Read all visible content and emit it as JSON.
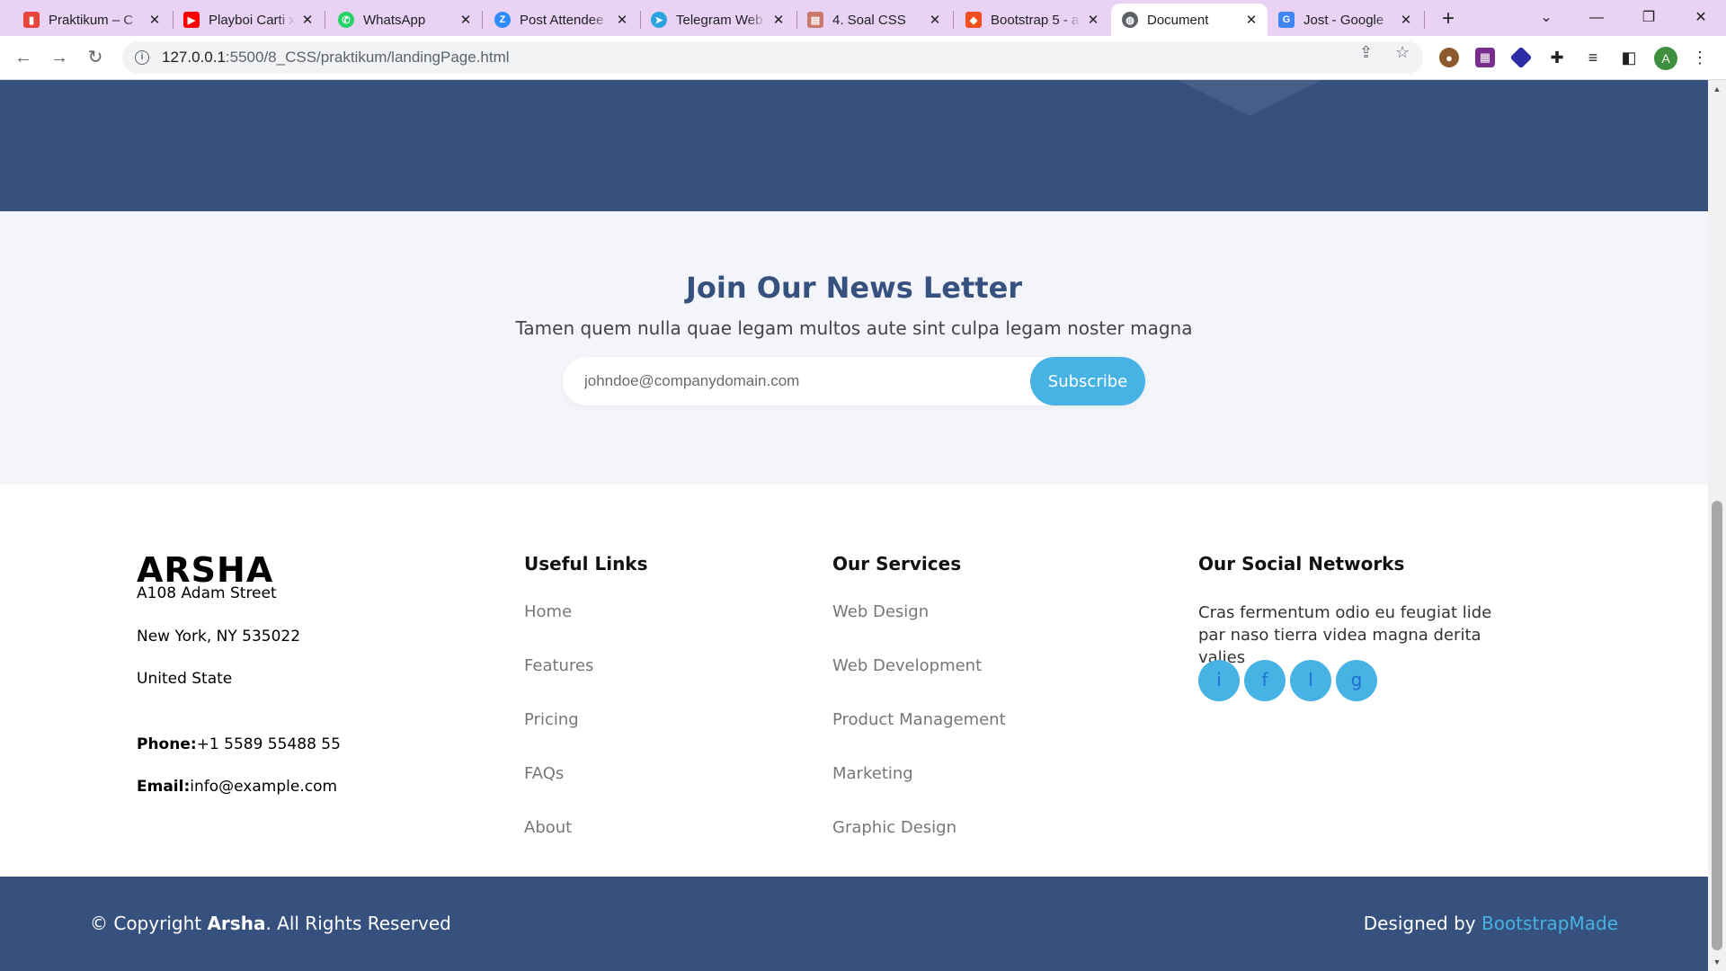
{
  "browser": {
    "tabs": [
      {
        "title": "Praktikum – C",
        "icon": "praktikum-icon",
        "color": "#e8453c"
      },
      {
        "title": "Playboi Carti x",
        "icon": "youtube-icon",
        "color": "#ff0000"
      },
      {
        "title": "WhatsApp",
        "icon": "whatsapp-icon",
        "color": "#25d366"
      },
      {
        "title": "Post Attendee",
        "icon": "zoom-icon",
        "color": "#2d8cff"
      },
      {
        "title": "Telegram Web",
        "icon": "telegram-icon",
        "color": "#2aa3e0"
      },
      {
        "title": "4. Soal CSS",
        "icon": "document-icon",
        "color": "#c9786b"
      },
      {
        "title": "Bootstrap 5 - a",
        "icon": "figma-icon",
        "color": "#f24e1e"
      },
      {
        "title": "Document",
        "icon": "globe-icon",
        "color": "#5f6368"
      },
      {
        "title": "Jost - Google",
        "icon": "google-fonts-icon",
        "color": "#4285f4"
      }
    ],
    "active_tab": 7,
    "new_tab_label": "+",
    "url_host": "127.0.0.1",
    "url_path": ":5500/8_CSS/praktikum/landingPage.html",
    "profile_initial": "A"
  },
  "newsletter": {
    "title": "Join Our News Letter",
    "subtitle": "Tamen quem nulla quae legam multos aute sint culpa legam noster magna",
    "email_placeholder": "johndoe@companydomain.com",
    "subscribe_label": "Subscribe"
  },
  "footer": {
    "brand": "ARSHA",
    "address": [
      "A108 Adam Street",
      "New York, NY 535022",
      "United State"
    ],
    "phone_label": "Phone:",
    "phone": "+1 5589 55488 55",
    "email_label": "Email:",
    "email": "info@example.com",
    "useful_links": {
      "heading": "Useful Links",
      "items": [
        "Home",
        "Features",
        "Pricing",
        "FAQs",
        "About"
      ]
    },
    "services": {
      "heading": "Our Services",
      "items": [
        "Web Design",
        "Web Development",
        "Product Management",
        "Marketing",
        "Graphic Design"
      ]
    },
    "social": {
      "heading": "Our Social Networks",
      "text": "Cras fermentum odio eu feugiat lide par naso tierra videa magna derita valies",
      "buttons": [
        "i",
        "f",
        "l",
        "g"
      ]
    },
    "copyright_prefix": "© Copyright ",
    "copyright_brand": "Arsha",
    "copyright_suffix": ". All Rights Reserved",
    "designed_by": "Designed by ",
    "designer": "BootstrapMade"
  }
}
